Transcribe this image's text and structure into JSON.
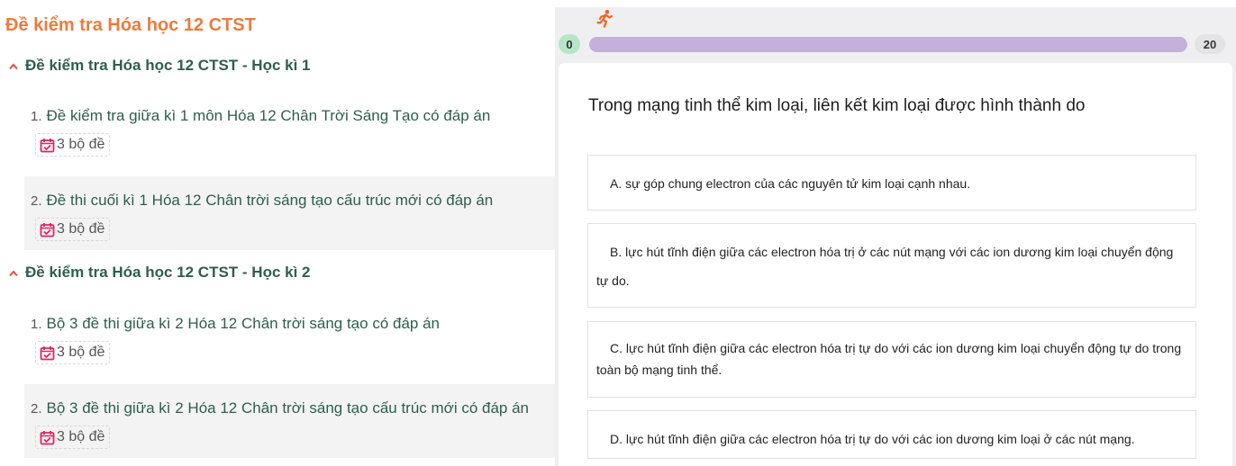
{
  "left": {
    "title": "Đề kiểm tra Hóa học 12 CTST",
    "sections": [
      {
        "title": "Đề kiểm tra Hóa học 12 CTST - Học kì 1",
        "items": [
          {
            "num": "1.",
            "title": "Đề kiểm tra giữa kì 1 môn Hóa 12 Chân Trời Sáng Tạo có đáp án",
            "badge": "3 bộ đề"
          },
          {
            "num": "2.",
            "title": "Đề thi cuối kì 1 Hóa 12 Chân trời sáng tạo cấu trúc mới có đáp án",
            "badge": "3 bộ đề"
          }
        ]
      },
      {
        "title": "Đề kiểm tra Hóa học 12 CTST - Học kì 2",
        "items": [
          {
            "num": "1.",
            "title": "Bộ 3 đề thi giữa kì 2 Hóa 12 Chân trời sáng tạo có đáp án",
            "badge": "3 bộ đề"
          },
          {
            "num": "2.",
            "title": "Bộ 3 đề thi giữa kì 2 Hóa 12 Chân trời sáng tạo cấu trúc mới có đáp án",
            "badge": "3 bộ đề"
          }
        ]
      }
    ]
  },
  "quiz": {
    "progress": {
      "start": "0",
      "end": "20",
      "value": 0
    },
    "question": "Trong mạng tinh thể kim loại, liên kết kim loại được hình thành do",
    "options": [
      {
        "letter": "A.",
        "text": "A. sự góp chung electron của các nguyên tử kim loại cạnh nhau."
      },
      {
        "letter": "B.",
        "text": "B. lực hút tĩnh điện giữa các electron hóa trị ở các nút mạng với các ion dương kim loại chuyển động tự do."
      },
      {
        "letter": "C.",
        "text": "C. lực hút tĩnh điện giữa các electron hóa trị tự do với các ion dương kim loại chuyển động tự do trong toàn bộ mạng tinh thể."
      },
      {
        "letter": "D.",
        "text": "D. lực hút tĩnh điện giữa các electron hóa trị tự do với các ion dương kim loại ở các nút mạng."
      }
    ]
  },
  "icons": {
    "caret": "chevron-up-icon",
    "badge": "calendar-check-icon",
    "runner": "running-person-icon"
  },
  "colors": {
    "title_orange": "#ec7b3d",
    "section_green": "#2e5e4e",
    "badge_icon": "#e0245e",
    "progress_track": "#c4b1db",
    "runner": "#f26522"
  }
}
